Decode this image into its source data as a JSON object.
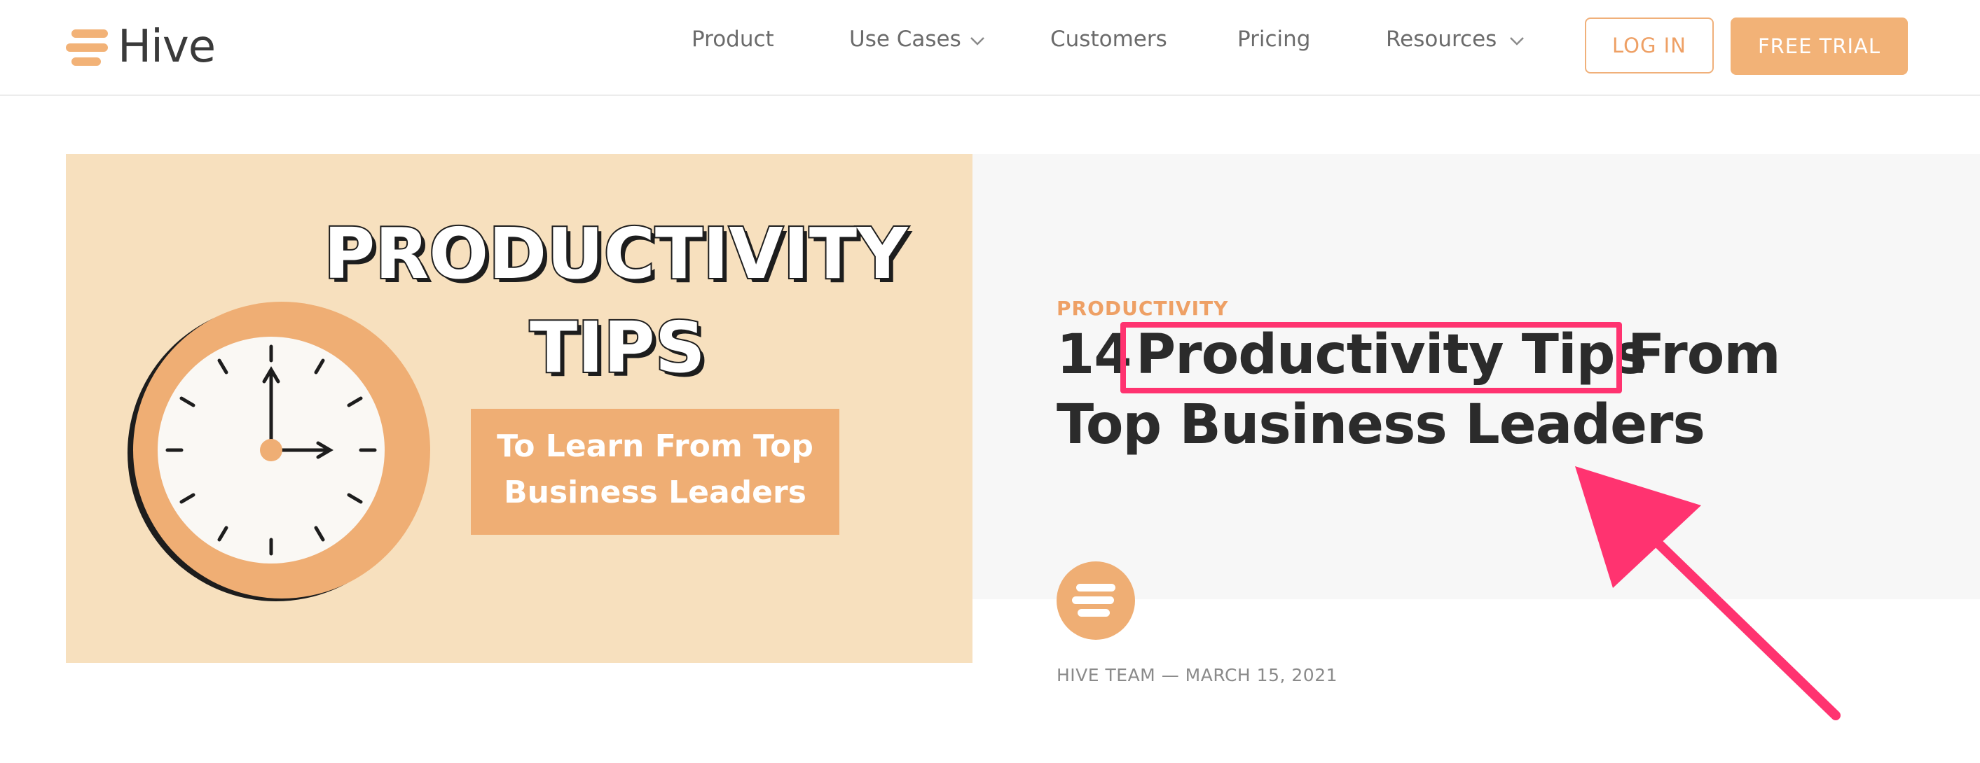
{
  "brand": {
    "name": "Hive",
    "color": "#f2b277"
  },
  "nav": {
    "items": [
      {
        "label": "Product",
        "has_dropdown": false
      },
      {
        "label": "Use Cases",
        "has_dropdown": true
      },
      {
        "label": "Customers",
        "has_dropdown": false
      },
      {
        "label": "Pricing",
        "has_dropdown": false
      },
      {
        "label": "Resources",
        "has_dropdown": true
      }
    ],
    "login_label": "LOG IN",
    "trial_label": "FREE TRIAL"
  },
  "hero_image": {
    "title_line1": "PRODUCTIVITY",
    "title_line2": "TIPS",
    "subtitle_line1": "To Learn From Top",
    "subtitle_line2": "Business Leaders",
    "background_color": "#f7e0be",
    "accent_color": "#efae74"
  },
  "article": {
    "category": "PRODUCTIVITY",
    "title_prefix": "14",
    "title_highlight": "Productivity Tips",
    "title_suffix": "From",
    "title_line2": "Top Business Leaders",
    "author": "HIVE TEAM",
    "date": "MARCH 15, 2021",
    "byline_separator": "—"
  },
  "annotation": {
    "highlight_color": "#ff3370",
    "arrow_color": "#ff3370",
    "icons": [
      "highlight-box",
      "pointer-arrow"
    ]
  }
}
